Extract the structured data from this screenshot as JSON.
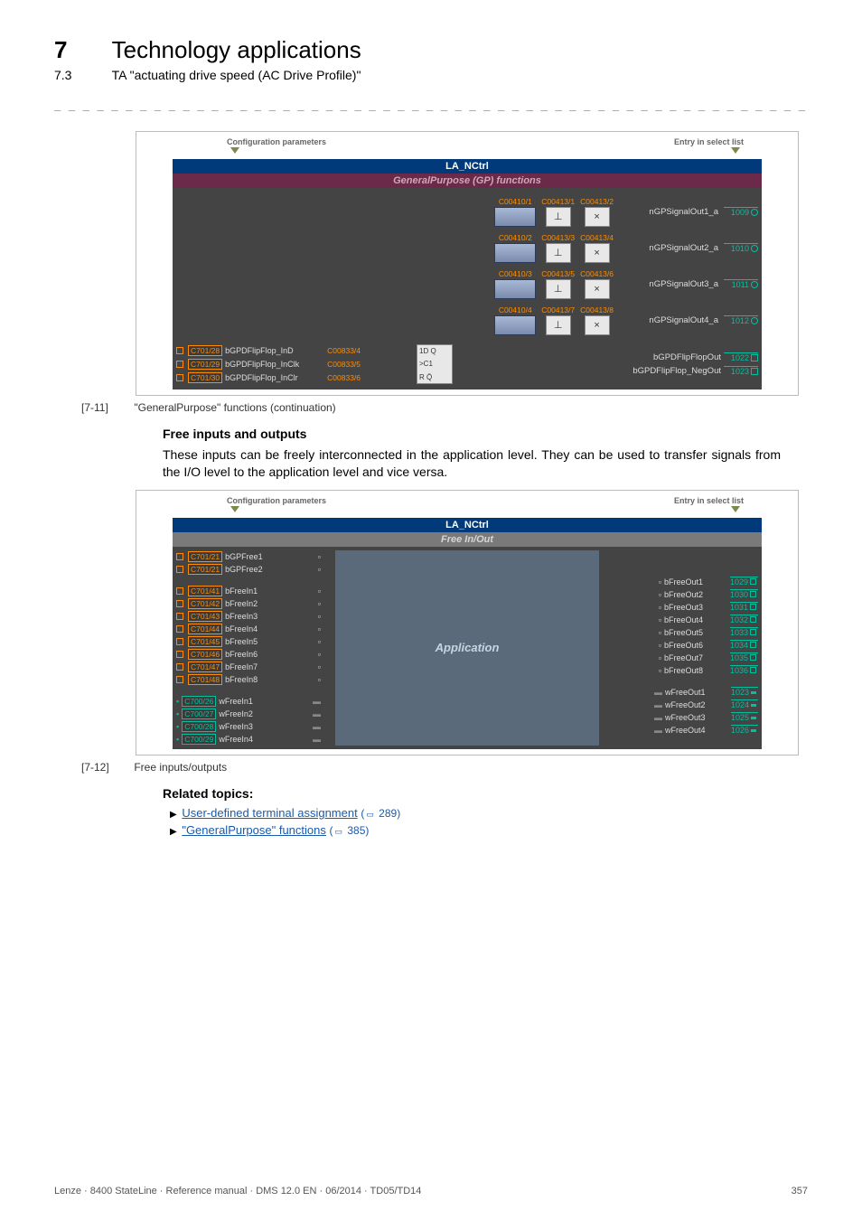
{
  "chapter_num": "7",
  "chapter_title": "Technology applications",
  "section_num": "7.3",
  "section_title": "TA \"actuating drive speed (AC Drive Profile)\"",
  "dashrow": "_ _ _ _ _ _ _ _ _ _ _ _ _ _ _ _ _ _ _ _ _ _ _ _ _ _ _ _ _ _ _ _ _ _ _ _ _ _ _ _ _ _ _ _ _ _ _ _ _ _ _ _ _ _ _ _ _ _ _ _ _ _ _ _",
  "fig1": {
    "conf_label": "Configuration parameters",
    "entry_label": "Entry in select list",
    "titlebar": "LA_NCtrl",
    "subbar": "GeneralPurpose (GP) functions",
    "rows": [
      {
        "p1": "C00410/1",
        "p2": "C00413/1",
        "p3": "C00413/2",
        "out": "nGPSignalOut1_a",
        "num": "1009"
      },
      {
        "p1": "C00410/2",
        "p2": "C00413/3",
        "p3": "C00413/4",
        "out": "nGPSignalOut2_a",
        "num": "1010"
      },
      {
        "p1": "C00410/3",
        "p2": "C00413/5",
        "p3": "C00413/6",
        "out": "nGPSignalOut3_a",
        "num": "1011"
      },
      {
        "p1": "C00410/4",
        "p2": "C00413/7",
        "p3": "C00413/8",
        "out": "nGPSignalOut4_a",
        "num": "1012"
      }
    ],
    "ff_ins": [
      {
        "port": "C701/28",
        "name": "bGPDFlipFlop_InD",
        "param": "C00833/4"
      },
      {
        "port": "C701/29",
        "name": "bGPDFlipFlop_InClk",
        "param": "C00833/5"
      },
      {
        "port": "C701/30",
        "name": "bGPDFlipFlop_InClr",
        "param": "C00833/6"
      }
    ],
    "ff_box": {
      "l1": "1D  Q",
      "l2": "C1",
      "l3": "R    Q̄"
    },
    "ff_outs": [
      {
        "name": "bGPDFlipFlopOut",
        "num": "1022"
      },
      {
        "name": "bGPDFlipFlop_NegOut",
        "num": "1023"
      }
    ],
    "caption_id": "[7-11]",
    "caption_txt": "\"GeneralPurpose\" functions (continuation)"
  },
  "free_title": "Free inputs and outputs",
  "free_para": "These inputs can be freely interconnected in the application level. They can be used to transfer signals from the I/O level to the application level and vice versa.",
  "fig2": {
    "conf_label": "Configuration parameters",
    "entry_label": "Entry in select list",
    "titlebar": "LA_NCtrl",
    "subbar": "Free In/Out",
    "gpfree_ports": [
      {
        "port": "C701/21",
        "name": "bGPFree1"
      },
      {
        "port": "C701/21",
        "name": "bGPFree2"
      }
    ],
    "bFreeIn": [
      {
        "port": "C701/41",
        "name": "bFreeIn1"
      },
      {
        "port": "C701/42",
        "name": "bFreeIn2"
      },
      {
        "port": "C701/43",
        "name": "bFreeIn3"
      },
      {
        "port": "C701/44",
        "name": "bFreeIn4"
      },
      {
        "port": "C701/45",
        "name": "bFreeIn5"
      },
      {
        "port": "C701/46",
        "name": "bFreeIn6"
      },
      {
        "port": "C701/47",
        "name": "bFreeIn7"
      },
      {
        "port": "C701/48",
        "name": "bFreeIn8"
      }
    ],
    "wFreeIn": [
      {
        "port": "C700/26",
        "name": "wFreeIn1"
      },
      {
        "port": "C700/27",
        "name": "wFreeIn2"
      },
      {
        "port": "C700/28",
        "name": "wFreeIn3"
      },
      {
        "port": "C700/29",
        "name": "wFreeIn4"
      }
    ],
    "bFreeOut": [
      {
        "name": "bFreeOut1",
        "num": "1029"
      },
      {
        "name": "bFreeOut2",
        "num": "1030"
      },
      {
        "name": "bFreeOut3",
        "num": "1031"
      },
      {
        "name": "bFreeOut4",
        "num": "1032"
      },
      {
        "name": "bFreeOut5",
        "num": "1033"
      },
      {
        "name": "bFreeOut6",
        "num": "1034"
      },
      {
        "name": "bFreeOut7",
        "num": "1035"
      },
      {
        "name": "bFreeOut8",
        "num": "1036"
      }
    ],
    "wFreeOut": [
      {
        "name": "wFreeOut1",
        "num": "1023"
      },
      {
        "name": "wFreeOut2",
        "num": "1024"
      },
      {
        "name": "wFreeOut3",
        "num": "1025"
      },
      {
        "name": "wFreeOut4",
        "num": "1026"
      }
    ],
    "app_label": "Application",
    "caption_id": "[7-12]",
    "caption_txt": "Free inputs/outputs"
  },
  "related_title": "Related topics:",
  "related": [
    {
      "text": "User-defined terminal assignment",
      "page": "289"
    },
    {
      "text": "\"GeneralPurpose\" functions",
      "page": "385"
    }
  ],
  "footer_left": "Lenze · 8400 StateLine · Reference manual · DMS 12.0 EN · 06/2014 · TD05/TD14",
  "footer_right": "357"
}
